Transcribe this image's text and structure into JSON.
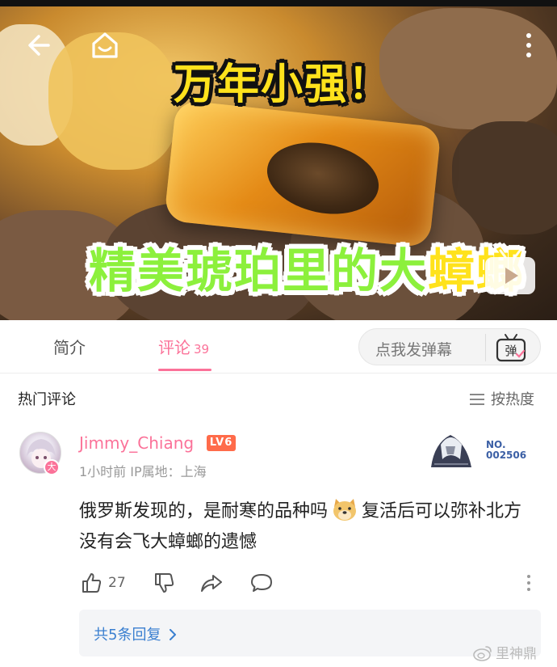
{
  "video": {
    "caption_top": "万年小强！",
    "caption_bottom_main": "精美琥珀里的大",
    "caption_bottom_tail": "蟑螂"
  },
  "tabs": {
    "intro_label": "简介",
    "comments_label": "评论",
    "comments_count": "39"
  },
  "danmaku": {
    "placeholder": "点我发弹幕",
    "icon_text": "弹"
  },
  "comments_section": {
    "heading": "热门评论",
    "sort_label": "按热度"
  },
  "comment": {
    "username": "Jimmy_Chiang",
    "level_badge": "LV6",
    "avatar_badge": "大",
    "meta": "1小时前 IP属地：上海",
    "medal_label_top": "NO.",
    "medal_label_bottom": "002506",
    "text_before_emoji": "俄罗斯发现的，是耐寒的品种吗",
    "text_after_emoji": "复活后可以弥补北方没有会飞大蟑螂的遗憾",
    "like_count": "27",
    "replies_label": "共5条回复"
  },
  "watermark": "里神鼎",
  "icons": [
    "back-icon",
    "home-icon",
    "more-icon",
    "tv-icon",
    "danmaku-icon",
    "sort-icon",
    "like-icon",
    "dislike-icon",
    "share-icon",
    "reply-icon",
    "menu-icon",
    "doge-emoji",
    "chevron-right-icon",
    "weibo-icon"
  ],
  "colors": {
    "accent": "#fb7299",
    "link": "#3a7fd0",
    "level": "#ff6b4a",
    "caption_yellow": "#ffe21c",
    "caption_green": "#8cf03c"
  }
}
